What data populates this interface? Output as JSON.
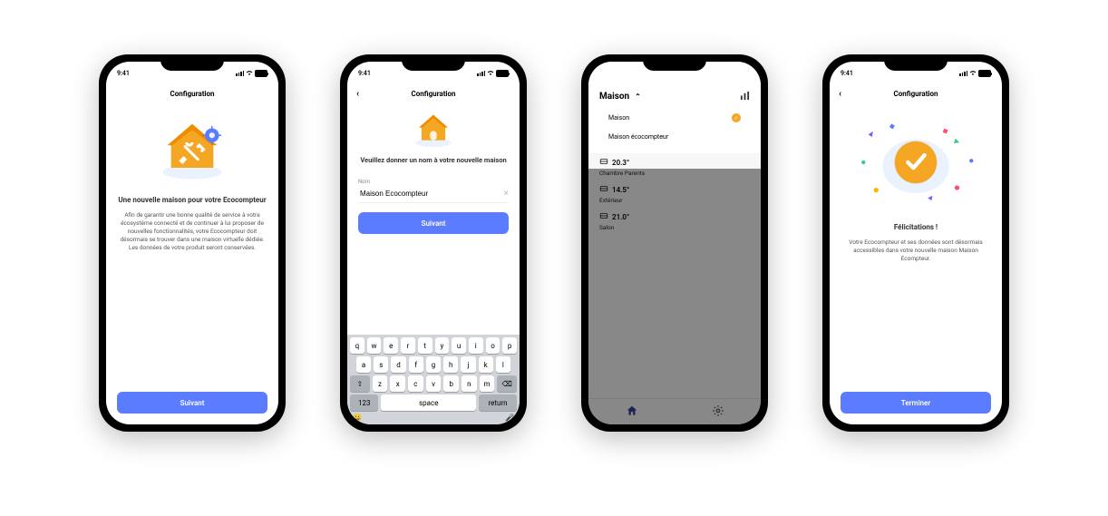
{
  "status": {
    "time": "9:41",
    "wifi_icon": "wifi"
  },
  "screen1": {
    "header": "Configuration",
    "title": "Une nouvelle maison pour votre Ecocompteur",
    "body": "Afin de garantir une bonne qualité de service à votre écosystème connecté et de continuer à lui proposer de nouvelles fonctionnalités, votre Ecocompteur doit désormais se trouver dans une maison virtuelle dédiée. Les données de votre produit seront conservées.",
    "button": "Suivant"
  },
  "screen2": {
    "header": "Configuration",
    "subtitle": "Veuillez donner un nom à votre nouvelle maison",
    "field_label": "Nom",
    "field_value": "Maison Ecocompteur",
    "button": "Suivant",
    "kbd": {
      "r1": [
        "q",
        "w",
        "e",
        "r",
        "t",
        "y",
        "u",
        "i",
        "o",
        "p"
      ],
      "r2": [
        "a",
        "s",
        "d",
        "f",
        "g",
        "h",
        "j",
        "k",
        "l"
      ],
      "r3_shift": "⇧",
      "r3": [
        "z",
        "x",
        "c",
        "v",
        "b",
        "n",
        "m"
      ],
      "r3_del": "⌫",
      "r4_123": "123",
      "r4_space": "space",
      "r4_return": "return",
      "emoji": "😀",
      "mic": "🎤"
    }
  },
  "screen3": {
    "dd_label": "Maison",
    "items": [
      {
        "label": "Maison",
        "checked": true
      },
      {
        "label": "Maison écocompteur",
        "checked": false
      }
    ],
    "rooms": [
      {
        "temp": "20.3°",
        "name": "Chambre Parents"
      },
      {
        "temp": "14.5°",
        "name": "Extérieur"
      },
      {
        "temp": "21.0°",
        "name": "Salon"
      }
    ]
  },
  "screen4": {
    "header": "Configuration",
    "title": "Félicitations !",
    "body": "Votre Ecocompteur et ses données sont désormais accessibles dans votre nouvelle maison Maison Ecompteur.",
    "button": "Terminer"
  }
}
